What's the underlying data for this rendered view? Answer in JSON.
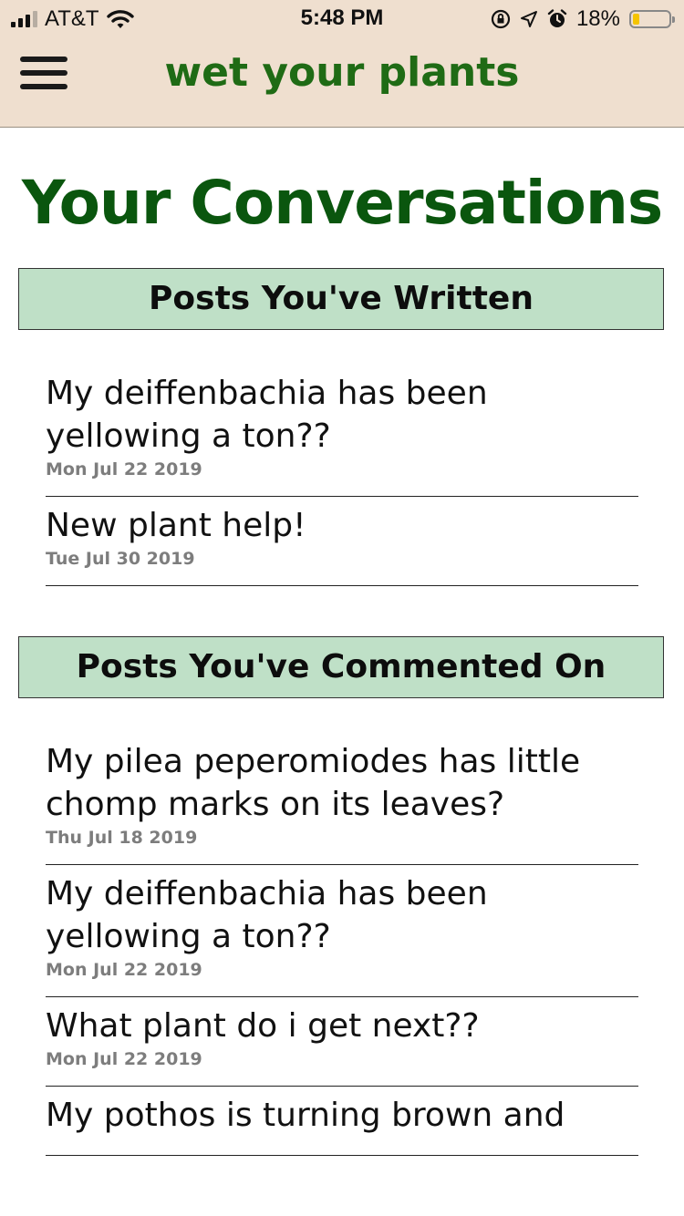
{
  "status_bar": {
    "carrier": "AT&T",
    "time": "5:48 PM",
    "battery_percent": "18%",
    "battery_level": 0.18,
    "icons": [
      "signal-icon",
      "wifi-icon",
      "orientation-lock-icon",
      "location-icon",
      "alarm-icon",
      "battery-icon"
    ]
  },
  "header": {
    "app_title": "wet your plants",
    "menu_icon": "hamburger-menu-icon"
  },
  "page_title": "Your Conversations",
  "sections": [
    {
      "title": "Posts You've Written",
      "posts": [
        {
          "title": "My deiffenbachia has been yellowing a ton??",
          "date": "Mon Jul 22 2019"
        },
        {
          "title": "New plant help!",
          "date": "Tue Jul 30 2019"
        }
      ]
    },
    {
      "title": "Posts You've Commented On",
      "posts": [
        {
          "title": "My pilea peperomiodes has little chomp marks on its leaves?",
          "date": "Thu Jul 18 2019"
        },
        {
          "title": "My deiffenbachia has been yellowing a ton??",
          "date": "Mon Jul 22 2019"
        },
        {
          "title": "What plant do i get next??",
          "date": "Mon Jul 22 2019"
        },
        {
          "title": "My pothos is turning brown and",
          "date": ""
        }
      ]
    }
  ],
  "colors": {
    "header_bg": "#efdfcf",
    "brand_green": "#1f6b15",
    "title_green": "#0a560e",
    "section_bg": "#bfe0c7",
    "date_gray": "#7d7d7d",
    "battery_yellow": "#f5c400"
  }
}
